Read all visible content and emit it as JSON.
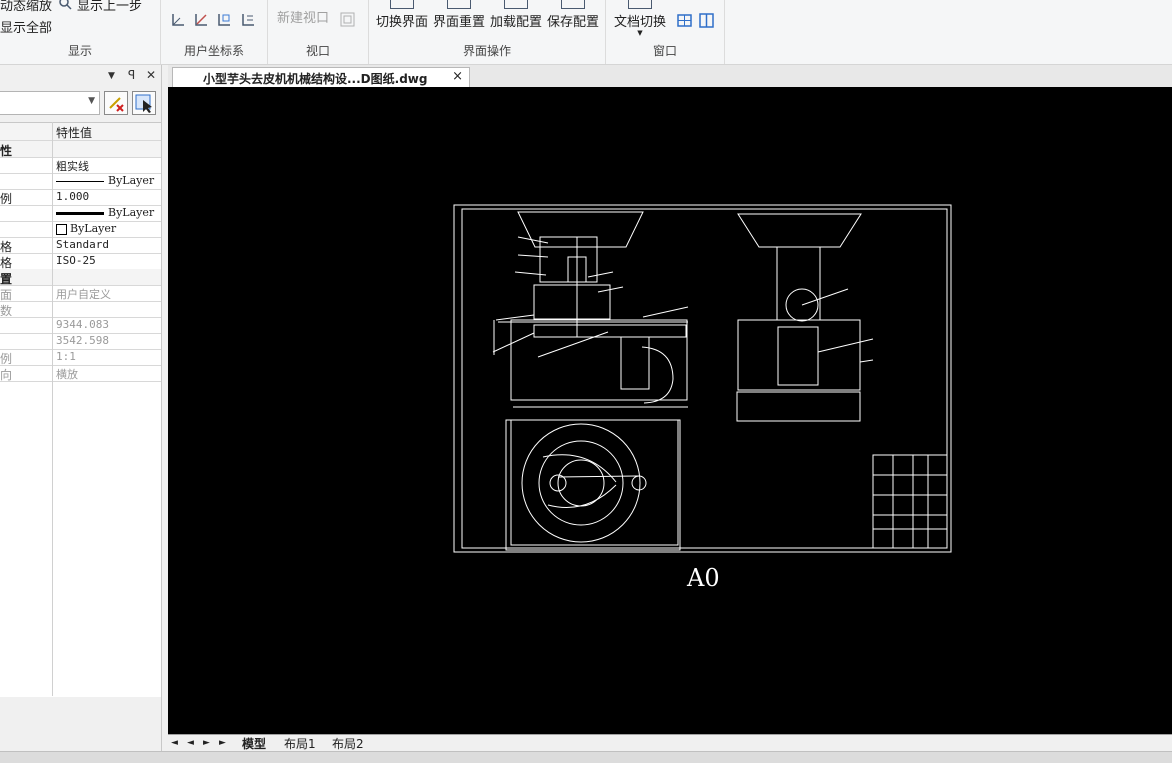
{
  "ribbon": {
    "display_group": {
      "label": "显示",
      "dynamic_zoom": "动态缩放",
      "previous_view": "显示上一步",
      "show_all": "显示全部"
    },
    "ucs_group": {
      "label": "用户坐标系"
    },
    "viewport_group": {
      "label": "视口",
      "new_viewport": "新建视口"
    },
    "ui_ops_group": {
      "label": "界面操作",
      "switch_ui": "切换界面",
      "reset_ui": "界面重置",
      "load_config": "加载配置",
      "save_config": "保存配置"
    },
    "window_group": {
      "label": "窗口",
      "doc_switch": "文档切换"
    }
  },
  "properties_panel": {
    "title_controls": {
      "dropdown": "▼",
      "pin": "ꟼ",
      "close": "✕"
    },
    "header": {
      "value_col": "特性值"
    },
    "rows": [
      {
        "key": "性",
        "value": "",
        "type": "section"
      },
      {
        "key": "",
        "value": "粗实线"
      },
      {
        "key": "",
        "value": "ByLayer",
        "swatch": "thin-line"
      },
      {
        "key": "例",
        "value": "1.000"
      },
      {
        "key": "",
        "value": "ByLayer",
        "swatch": "thick-line"
      },
      {
        "key": "",
        "value": "ByLayer",
        "swatch": "box"
      },
      {
        "key": "格",
        "value": "Standard"
      },
      {
        "key": "格",
        "value": "ISO-25"
      },
      {
        "key": "置",
        "value": "",
        "type": "section"
      },
      {
        "key": "面",
        "value": "用户自定义",
        "dim": true
      },
      {
        "key": "数",
        "value": "",
        "dim": true
      },
      {
        "key": "",
        "value": "9344.083",
        "dim": true
      },
      {
        "key": "",
        "value": "3542.598",
        "dim": true
      },
      {
        "key": "例",
        "value": "1:1",
        "dim": true
      },
      {
        "key": "向",
        "value": "横放",
        "dim": true
      }
    ]
  },
  "document_tab": {
    "title": "小型芋头去皮机机械结构设...D图纸.dwg",
    "close": "×"
  },
  "drawing": {
    "sheet_label": "A0"
  },
  "layout_tabs": {
    "nav": [
      "◄",
      "◄",
      "►",
      "►"
    ],
    "tabs": [
      "模型",
      "布局1",
      "布局2"
    ]
  },
  "colors": {
    "canvas": "#000000",
    "ribbon": "#f5f6f7",
    "drawing_line": "#ffffff"
  }
}
